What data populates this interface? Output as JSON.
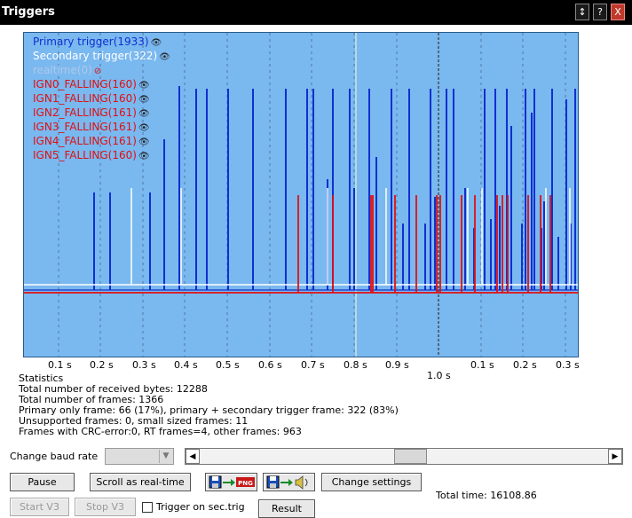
{
  "window": {
    "title": "Triggers",
    "buttons": [
      "↕",
      "?",
      "X"
    ]
  },
  "legend": [
    {
      "label": "Primary trigger(1933)",
      "color": "#1030d0"
    },
    {
      "label": "Secondary trigger(322)",
      "color": "#ffffff"
    },
    {
      "label": "realtime(0)",
      "color": "#b0c8e8"
    },
    {
      "label": "IGN0_FALLING(160)",
      "color": "#e01010"
    },
    {
      "label": "IGN1_FALLING(160)",
      "color": "#e01010"
    },
    {
      "label": "IGN2_FALLING(161)",
      "color": "#e01010"
    },
    {
      "label": "IGN3_FALLING(161)",
      "color": "#e01010"
    },
    {
      "label": "IGN4_FALLING(161)",
      "color": "#e01010"
    },
    {
      "label": "IGN5_FALLING(160)",
      "color": "#e01010"
    }
  ],
  "axis": {
    "ticks": [
      "0.1 s",
      "0.2 s",
      "0.3 s",
      "0.4 s",
      "0.5 s",
      "0.6 s",
      "0.7 s",
      "0.8 s",
      "0.9 s",
      "0.1 s",
      "0.2 s",
      "0.3 s"
    ],
    "major_label": "1.0 s"
  },
  "stats": {
    "heading": "Statistics",
    "bytes": "Total number of received bytes: 12288",
    "frames": "Total number of frames: 1366",
    "primary": "Primary only frame: 66 (17%), primary + secondary trigger frame: 322 (83%)",
    "unsupported": "Unsupported frames: 0, small sized frames: 11",
    "crc": "Frames with CRC-error:0, RT frames=4, other frames: 963"
  },
  "baud_label": "Change baud rate",
  "buttons": {
    "pause": "Pause",
    "scroll_realtime": "Scroll as real-time",
    "png_badge": "PNG",
    "change_settings": "Change settings",
    "start_v3": "Start V3",
    "stop_v3": "Stop V3",
    "result": "Result"
  },
  "total_time": "Total time: 16108.86",
  "trigger_checkbox_label": "Trigger on sec.trig",
  "icons": {
    "save": "floppy-icon",
    "export_png": "png-export-icon",
    "sound": "speaker-icon",
    "eye": "eye-icon"
  },
  "colors": {
    "plot_bg": "#7ab8f0",
    "primary": "#1030d0",
    "secondary": "#ffffff",
    "ign": "#e01010"
  }
}
